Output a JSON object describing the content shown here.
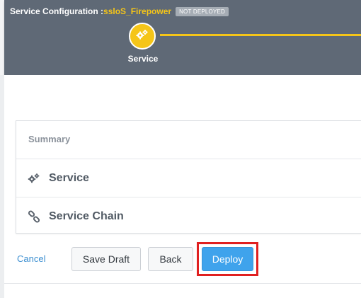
{
  "header": {
    "title_prefix": "Service Configuration :",
    "title_name": "ssloS_Firepower",
    "status_badge": "NOT DEPLOYED",
    "step": {
      "label": "Service",
      "icon": "gears-icon"
    }
  },
  "summary": {
    "title": "Summary",
    "rows": [
      {
        "label": "Service",
        "icon": "gears-icon"
      },
      {
        "label": "Service Chain",
        "icon": "chain-link-icon"
      }
    ]
  },
  "actions": {
    "cancel": "Cancel",
    "save_draft": "Save Draft",
    "back": "Back",
    "deploy": "Deploy"
  },
  "colors": {
    "header_bg": "#5f6976",
    "accent_yellow": "#f5c518",
    "deploy_blue": "#3fa3ec",
    "highlight_red": "#e02020",
    "link_blue": "#3c8fd1"
  }
}
